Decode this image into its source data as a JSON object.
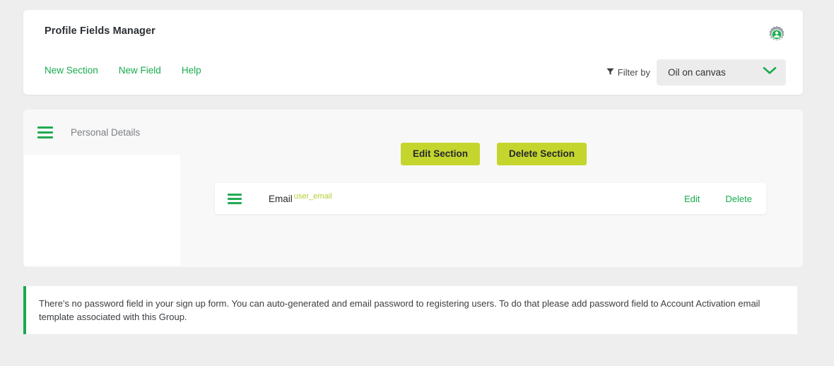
{
  "header": {
    "title": "Profile Fields Manager",
    "gear_icon": "gear-user-icon",
    "nav": [
      {
        "label": "New Section",
        "name": "new-section-link"
      },
      {
        "label": "New Field",
        "name": "new-field-link"
      },
      {
        "label": "Help",
        "name": "help-link"
      }
    ],
    "filter": {
      "icon": "filter-funnel-icon",
      "label": "Filter by",
      "selected": "Oil on canvas",
      "chevron_icon": "chevron-down-icon"
    }
  },
  "section": {
    "drag_handle_icon": "drag-handle-icon",
    "title": "Personal Details",
    "edit_button": "Edit Section",
    "delete_button": "Delete Section",
    "fields": [
      {
        "drag_handle_icon": "drag-handle-icon",
        "label": "Email",
        "key": "user_email",
        "edit_label": "Edit",
        "delete_label": "Delete"
      }
    ]
  },
  "notice": {
    "text": "There's no password field in your sign up form. You can auto-generated and email password to registering users. To do that please add password field to Account Activation email template associated with this Group."
  },
  "colors": {
    "green": "#18ab4f",
    "olive": "#c4d52e",
    "key_green": "#b6cc33",
    "page_bg": "#eeeeee",
    "section_bg": "#f8f8f8"
  }
}
